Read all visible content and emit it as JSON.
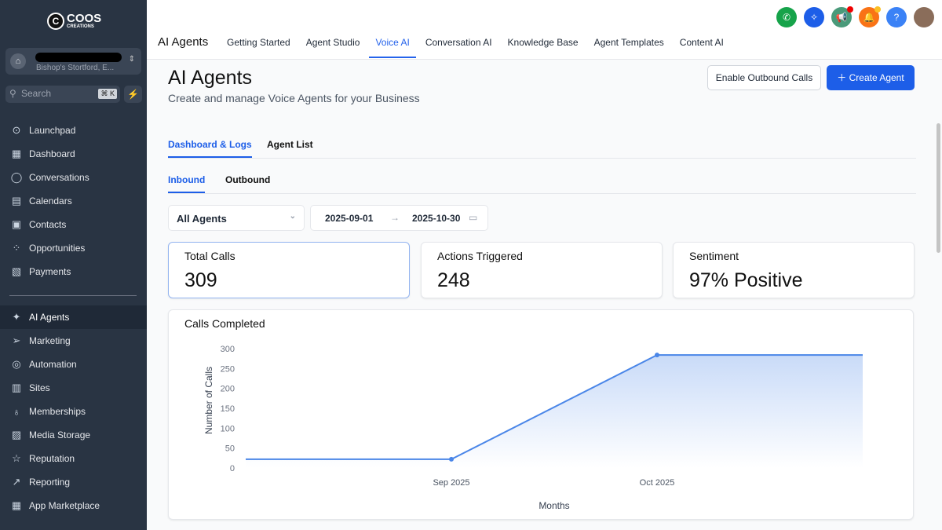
{
  "sidebar": {
    "logo": {
      "line1": "COOS",
      "line2": "CREATIONS"
    },
    "location_sub": "Bishop's Stortford, E...",
    "search_placeholder": "Search",
    "search_shortcut": "⌘ K",
    "items": [
      {
        "label": "Launchpad",
        "icon": "rocket-icon",
        "glyph": "⊙"
      },
      {
        "label": "Dashboard",
        "icon": "grid-icon",
        "glyph": "▦"
      },
      {
        "label": "Conversations",
        "icon": "chat-icon",
        "glyph": "◯"
      },
      {
        "label": "Calendars",
        "icon": "calendar-icon",
        "glyph": "▤"
      },
      {
        "label": "Contacts",
        "icon": "contacts-icon",
        "glyph": "▣"
      },
      {
        "label": "Opportunities",
        "icon": "opportunities-icon",
        "glyph": "⁘"
      },
      {
        "label": "Payments",
        "icon": "payments-icon",
        "glyph": "▧"
      },
      {
        "label": "AI Agents",
        "icon": "sparkle-icon",
        "glyph": "✦",
        "active": true
      },
      {
        "label": "Marketing",
        "icon": "send-icon",
        "glyph": "➢"
      },
      {
        "label": "Automation",
        "icon": "automation-icon",
        "glyph": "◎"
      },
      {
        "label": "Sites",
        "icon": "sites-icon",
        "glyph": "▥"
      },
      {
        "label": "Memberships",
        "icon": "badge-icon",
        "glyph": "♁"
      },
      {
        "label": "Media Storage",
        "icon": "image-icon",
        "glyph": "▨"
      },
      {
        "label": "Reputation",
        "icon": "star-icon",
        "glyph": "☆"
      },
      {
        "label": "Reporting",
        "icon": "trend-icon",
        "glyph": "↗"
      },
      {
        "label": "App Marketplace",
        "icon": "apps-icon",
        "glyph": "▦"
      }
    ]
  },
  "topbar": {
    "title": "AI Agents",
    "tabs": [
      "Getting Started",
      "Agent Studio",
      "Voice AI",
      "Conversation AI",
      "Knowledge Base",
      "Agent Templates",
      "Content AI"
    ],
    "active_tab": "Voice AI",
    "icons": [
      {
        "name": "phone-icon",
        "glyph": "✆",
        "color": "#16a34a"
      },
      {
        "name": "sparkle-icon",
        "glyph": "✧",
        "color": "#1d5ee8"
      },
      {
        "name": "megaphone-icon",
        "glyph": "📢",
        "color": "#4a9a7a",
        "badge": "#ef0000"
      },
      {
        "name": "bell-icon",
        "glyph": "🔔",
        "color": "#f97316",
        "badge": "#fbbf24"
      },
      {
        "name": "help-icon",
        "glyph": "?",
        "color": "#3b82f6"
      }
    ]
  },
  "page": {
    "title": "AI Agents",
    "subtitle": "Create and manage Voice Agents for your Business",
    "enable_outbound": "Enable Outbound Calls",
    "create_agent": "Create Agent",
    "tabs": [
      "Dashboard & Logs",
      "Agent List"
    ],
    "subtabs": [
      "Inbound",
      "Outbound"
    ],
    "agent_filter": "All Agents",
    "date_from": "2025-09-01",
    "date_to": "2025-10-30"
  },
  "stats": [
    {
      "label": "Total Calls",
      "value": "309"
    },
    {
      "label": "Actions Triggered",
      "value": "248"
    },
    {
      "label": "Sentiment",
      "value": "97% Positive"
    }
  ],
  "chart_data": {
    "type": "area",
    "title": "Calls Completed",
    "xlabel": "Months",
    "ylabel": "Number of Calls",
    "categories": [
      "",
      "Sep 2025",
      "Oct 2025",
      ""
    ],
    "values": [
      22,
      22,
      284,
      284
    ],
    "marked_points": [
      1,
      2
    ],
    "yticks": [
      0,
      50,
      100,
      150,
      200,
      250,
      300
    ],
    "ylim": [
      0,
      300
    ],
    "color": "#4a86e8"
  }
}
